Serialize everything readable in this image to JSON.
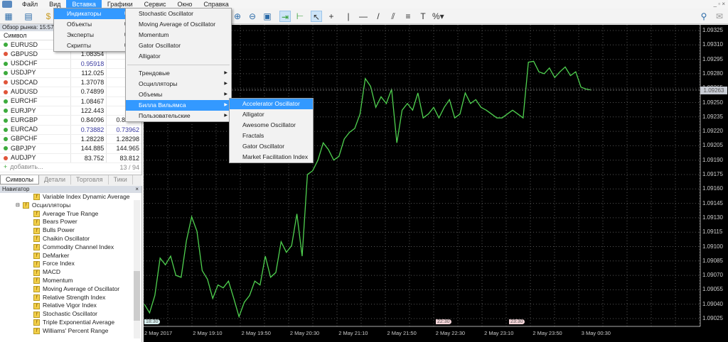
{
  "menubar": {
    "items": [
      "Файл",
      "Вид",
      "Вставка",
      "Графики",
      "Сервис",
      "Окно",
      "Справка"
    ],
    "active_index": 2
  },
  "window_controls": "_ ▫ ×",
  "market_watch": {
    "title": "Обзор рынка: 15:57",
    "col_symbol": "Символ",
    "rows": [
      {
        "symbol": "EURUSD",
        "dir": "up",
        "bid": "",
        "ask": "",
        "blue": false
      },
      {
        "symbol": "GBPUSD",
        "dir": "down",
        "bid": "1.08354",
        "ask": "",
        "blue": false
      },
      {
        "symbol": "USDCHF",
        "dir": "up",
        "bid": "0.95918",
        "ask": "",
        "blue": true
      },
      {
        "symbol": "USDJPY",
        "dir": "up",
        "bid": "112.025",
        "ask": "",
        "blue": false
      },
      {
        "symbol": "USDCAD",
        "dir": "down",
        "bid": "1.37078",
        "ask": "",
        "blue": false
      },
      {
        "symbol": "AUDUSD",
        "dir": "down",
        "bid": "0.74899",
        "ask": "",
        "blue": false
      },
      {
        "symbol": "EURCHF",
        "dir": "up",
        "bid": "1.08467",
        "ask": "",
        "blue": false
      },
      {
        "symbol": "EURJPY",
        "dir": "up",
        "bid": "122.443",
        "ask": "",
        "blue": false
      },
      {
        "symbol": "EURGBP",
        "dir": "up",
        "bid": "0.84096",
        "ask": "0.84126",
        "blue": false
      },
      {
        "symbol": "EURCAD",
        "dir": "up",
        "bid": "0.73882",
        "ask": "0.73962",
        "blue": true
      },
      {
        "symbol": "GBPCHF",
        "dir": "up",
        "bid": "1.28228",
        "ask": "1.28298",
        "blue": false
      },
      {
        "symbol": "GBPJPY",
        "dir": "up",
        "bid": "144.885",
        "ask": "144.965",
        "blue": false
      },
      {
        "symbol": "AUDJPY",
        "dir": "down",
        "bid": "83.752",
        "ask": "83.812",
        "blue": false
      }
    ],
    "add_label": "добавить...",
    "count": "13 / 94",
    "tabs": [
      "Символы",
      "Детали",
      "Торговля",
      "Тики"
    ]
  },
  "navigator": {
    "title": "Навигатор",
    "close": "×",
    "top_item": "Variable Index Dynamic Average",
    "folder": "Осцилляторы",
    "items": [
      "Average True Range",
      "Bears Power",
      "Bulls Power",
      "Chaikin Oscillator",
      "Commodity Channel Index",
      "DeMarker",
      "Force Index",
      "MACD",
      "Momentum",
      "Moving Average of Oscillator",
      "Relative Strength Index",
      "Relative Vigor Index",
      "Stochastic Oscillator",
      "Triple Exponential Average",
      "Williams' Percent Range"
    ]
  },
  "insert_menu": {
    "items": [
      "Индикаторы",
      "Объекты",
      "Эксперты",
      "Скрипты"
    ]
  },
  "indicators_menu": {
    "top": [
      "Stochastic Oscillator",
      "Moving Average of Oscillator",
      "Momentum",
      "Gator Oscillator",
      "Alligator"
    ],
    "groups": [
      "Трендовые",
      "Осцилляторы",
      "Объемы",
      "Билла Вильямса",
      "Пользовательские"
    ]
  },
  "williams_menu": {
    "items": [
      "Accelerator Oscillator",
      "Alligator",
      "Awesome Oscillator",
      "Fractals",
      "Gator Oscillator",
      "Market Facilitation Index"
    ]
  },
  "chart_data": {
    "type": "line",
    "color": "#4fd14f",
    "current_price": "1.09263",
    "y_ticks": [
      "1.09325",
      "1.09310",
      "1.09295",
      "1.09280",
      "1.09265",
      "1.09250",
      "1.09235",
      "1.09220",
      "1.09205",
      "1.09190",
      "1.09175",
      "1.09160",
      "1.09145",
      "1.09130",
      "1.09115",
      "1.09100",
      "1.09085",
      "1.09070",
      "1.09055",
      "1.09040",
      "1.09025"
    ],
    "ylim": [
      1.09025,
      1.09325
    ],
    "x_ticks": [
      "2 May 2017",
      "2 May 19:10",
      "2 May 19:50",
      "2 May 20:30",
      "2 May 21:10",
      "2 May 21:50",
      "2 May 22:30",
      "2 May 23:10",
      "2 May 23:50",
      "3 May 00:30"
    ],
    "markers": [
      {
        "label": "18:30",
        "type": "start"
      },
      {
        "label": "22:30",
        "type": "session"
      },
      {
        "label": "23:30",
        "type": "session"
      }
    ],
    "values": [
      1.0904,
      1.09031,
      1.09049,
      1.09088,
      1.09081,
      1.0909,
      1.0907,
      1.09068,
      1.09106,
      1.09131,
      1.09116,
      1.09075,
      1.09066,
      1.09046,
      1.0906,
      1.09057,
      1.09064,
      1.09046,
      1.09027,
      1.09042,
      1.09049,
      1.09064,
      1.0906,
      1.0909,
      1.09068,
      1.09073,
      1.09105,
      1.09094,
      1.09101,
      1.09134,
      1.0909,
      1.09175,
      1.09179,
      1.0919,
      1.09208,
      1.09201,
      1.0919,
      1.09194,
      1.09212,
      1.09219,
      1.09223,
      1.09238,
      1.09275,
      1.09267,
      1.09245,
      1.09256,
      1.09249,
      1.09264,
      1.09208,
      1.09242,
      1.09249,
      1.09242,
      1.0926,
      1.09234,
      1.09238,
      1.09245,
      1.09234,
      1.09245,
      1.09253,
      1.09234,
      1.09238,
      1.0926,
      1.09249,
      1.09253,
      1.09245,
      1.09242,
      1.09238,
      1.09234,
      1.09234,
      1.09238,
      1.09242,
      1.09238,
      1.09234,
      1.09292,
      1.09293,
      1.09282,
      1.0928,
      1.09286,
      1.09276,
      1.09282,
      1.09287,
      1.09278,
      1.09282,
      1.09266,
      1.09264,
      1.09263
    ]
  }
}
